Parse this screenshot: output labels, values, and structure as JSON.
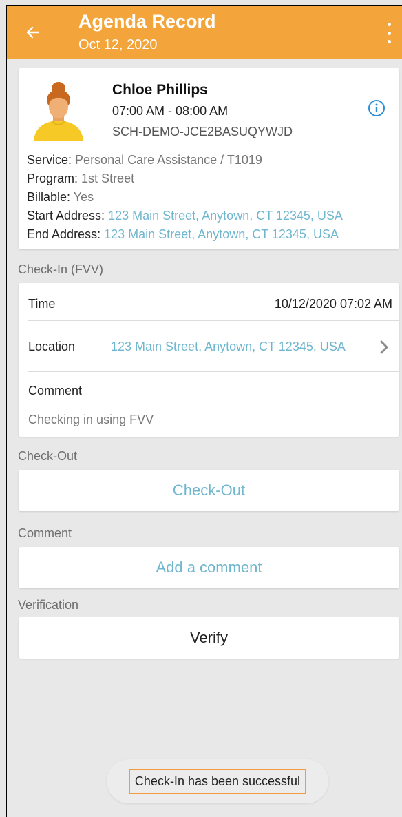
{
  "header": {
    "title": "Agenda Record",
    "date": "Oct 12, 2020",
    "back_icon": "arrow-left-icon",
    "menu_icon": "more-vertical-icon",
    "color": "#f3a43a"
  },
  "client": {
    "name": "Chloe Phillips",
    "time_range": "07:00 AM - 08:00 AM",
    "code": "SCH-DEMO-JCE2BASUQYWJD",
    "info_icon": "info-circle-icon",
    "details": {
      "service_label": "Service:",
      "service_value": "Personal Care Assistance / T1019",
      "program_label": "Program:",
      "program_value": "1st Street",
      "billable_label": "Billable:",
      "billable_value": "Yes",
      "start_address_label": "Start Address:",
      "start_address_value": "123 Main Street, Anytown, CT 12345, USA",
      "end_address_label": "End Address:",
      "end_address_value": "123 Main Street, Anytown, CT 12345, USA"
    }
  },
  "checkin": {
    "section_label": "Check-In (FVV)",
    "time_label": "Time",
    "time_value": "10/12/2020 07:02 AM",
    "location_label": "Location",
    "location_value": "123 Main Street, Anytown, CT 12345, USA",
    "comment_label": "Comment",
    "comment_value": "Checking in using FVV"
  },
  "checkout": {
    "section_label": "Check-Out",
    "button_label": "Check-Out"
  },
  "comment": {
    "section_label": "Comment",
    "button_label": "Add a comment"
  },
  "verification": {
    "section_label": "Verification",
    "button_label": "Verify"
  },
  "toast": {
    "message": "Check-In has been successful"
  },
  "colors": {
    "link": "#6fb6cf",
    "toast_border": "#f29a3c"
  }
}
